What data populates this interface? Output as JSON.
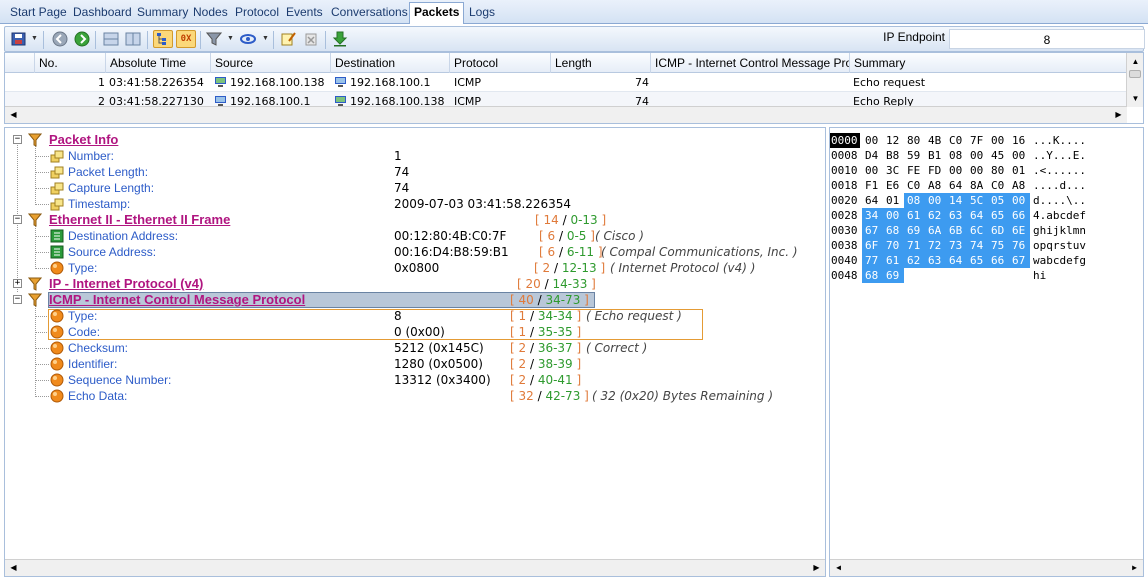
{
  "tabs": [
    {
      "label": "Start Page",
      "active": false
    },
    {
      "label": "Dashboard",
      "active": false
    },
    {
      "label": "Summary",
      "active": false
    },
    {
      "label": "Nodes",
      "active": false
    },
    {
      "label": "Protocol",
      "active": false
    },
    {
      "label": "Events",
      "active": false
    },
    {
      "label": "Conversations",
      "active": false
    },
    {
      "label": "Packets",
      "active": true
    },
    {
      "label": "Logs",
      "active": false
    }
  ],
  "toolbar": {
    "icons": [
      "save-icon",
      "back-icon",
      "forward-icon",
      "pane-layout-icon",
      "pane-split-icon",
      "tree-view-icon",
      "hex-view-icon",
      "filter-icon",
      "decode-options-icon",
      "edit-notes-icon",
      "delete-icon",
      "download-icon"
    ],
    "ip_endpoint_label": "IP Endpoint",
    "ip_endpoint_value": "8"
  },
  "grid": {
    "columns": [
      "No.",
      "Absolute Time",
      "Source",
      "Destination",
      "Protocol",
      "Length",
      "ICMP - Internet Control Message Prot...",
      "Summary"
    ],
    "rows": [
      {
        "no": "1",
        "time": "03:41:58.226354",
        "source": "192.168.100.138",
        "destination": "192.168.100.1",
        "protocol": "ICMP",
        "length": "74",
        "icmp": "",
        "summary": "Echo request"
      },
      {
        "no": "2",
        "time": "03:41:58.227130",
        "source": "192.168.100.1",
        "destination": "192.168.100.138",
        "protocol": "ICMP",
        "length": "74",
        "icmp": "",
        "summary": "Echo Reply"
      }
    ]
  },
  "tree": {
    "packet_info": {
      "title": "Packet Info",
      "fields": [
        {
          "name": "Number:",
          "value": "1"
        },
        {
          "name": "Packet Length:",
          "value": "74"
        },
        {
          "name": "Capture Length:",
          "value": "74"
        },
        {
          "name": "Timestamp:",
          "value": "2009-07-03 03:41:58.226354"
        }
      ]
    },
    "ethernet": {
      "title": "Ethernet II - Ethernet II Frame",
      "range": {
        "len": "14",
        "span": "0-13"
      },
      "fields": [
        {
          "name": "Destination Address:",
          "value": "00:12:80:4B:C0:7F",
          "len": "6",
          "span": "0-5",
          "desc": "Cisco"
        },
        {
          "name": "Source Address:",
          "value": "00:16:D4:B8:59:B1",
          "len": "6",
          "span": "6-11",
          "desc": "Compal Communications, Inc."
        },
        {
          "name": "Type:",
          "value": "0x0800",
          "len": "2",
          "span": "12-13",
          "desc": "Internet Protocol (v4)"
        }
      ]
    },
    "ip": {
      "title": "IP - Internet Protocol (v4)",
      "range": {
        "len": "20",
        "span": "14-33"
      }
    },
    "icmp": {
      "title": "ICMP - Internet Control Message Protocol",
      "range": {
        "len": "40",
        "span": "34-73"
      },
      "fields": [
        {
          "name": "Type:",
          "value": "8",
          "len": "1",
          "span": "34-34",
          "desc": "Echo request"
        },
        {
          "name": "Code:",
          "value": "0 (0x00)",
          "len": "1",
          "span": "35-35",
          "desc": ""
        },
        {
          "name": "Checksum:",
          "value": "5212 (0x145C)",
          "len": "2",
          "span": "36-37",
          "desc": "Correct"
        },
        {
          "name": "Identifier:",
          "value": "1280 (0x0500)",
          "len": "2",
          "span": "38-39",
          "desc": ""
        },
        {
          "name": "Sequence Number:",
          "value": "13312 (0x3400)",
          "len": "2",
          "span": "40-41",
          "desc": ""
        },
        {
          "name": "Echo Data:",
          "value": "",
          "len": "32",
          "span": "42-73",
          "desc": "32 (0x20) Bytes Remaining"
        }
      ]
    }
  },
  "hex": {
    "rows": [
      {
        "offset": "0000",
        "bytes": [
          "00",
          "12",
          "80",
          "4B",
          "C0",
          "7F",
          "00",
          "16"
        ],
        "ascii": "...K...."
      },
      {
        "offset": "0008",
        "bytes": [
          "D4",
          "B8",
          "59",
          "B1",
          "08",
          "00",
          "45",
          "00"
        ],
        "ascii": "..Y...E."
      },
      {
        "offset": "0010",
        "bytes": [
          "00",
          "3C",
          "FE",
          "FD",
          "00",
          "00",
          "80",
          "01"
        ],
        "ascii": ".<......"
      },
      {
        "offset": "0018",
        "bytes": [
          "F1",
          "E6",
          "C0",
          "A8",
          "64",
          "8A",
          "C0",
          "A8"
        ],
        "ascii": "....d..."
      },
      {
        "offset": "0020",
        "bytes": [
          "64",
          "01",
          "08",
          "00",
          "14",
          "5C",
          "05",
          "00"
        ],
        "ascii": "d....\\.."
      },
      {
        "offset": "0028",
        "bytes": [
          "34",
          "00",
          "61",
          "62",
          "63",
          "64",
          "65",
          "66"
        ],
        "ascii": "4.abcdef"
      },
      {
        "offset": "0030",
        "bytes": [
          "67",
          "68",
          "69",
          "6A",
          "6B",
          "6C",
          "6D",
          "6E"
        ],
        "ascii": "ghijklmn"
      },
      {
        "offset": "0038",
        "bytes": [
          "6F",
          "70",
          "71",
          "72",
          "73",
          "74",
          "75",
          "76"
        ],
        "ascii": "opqrstuv"
      },
      {
        "offset": "0040",
        "bytes": [
          "77",
          "61",
          "62",
          "63",
          "64",
          "65",
          "66",
          "67"
        ],
        "ascii": "wabcdefg"
      },
      {
        "offset": "0048",
        "bytes": [
          "68",
          "69"
        ],
        "ascii": "hi"
      }
    ],
    "selection_start": 34,
    "selection_end": 73
  },
  "colors": {
    "section": "#b01580",
    "field": "#2d5cc8",
    "range_len": "#e07a3a",
    "range_span": "#2e9a2e",
    "hex_selection": "#3d9bf0"
  }
}
